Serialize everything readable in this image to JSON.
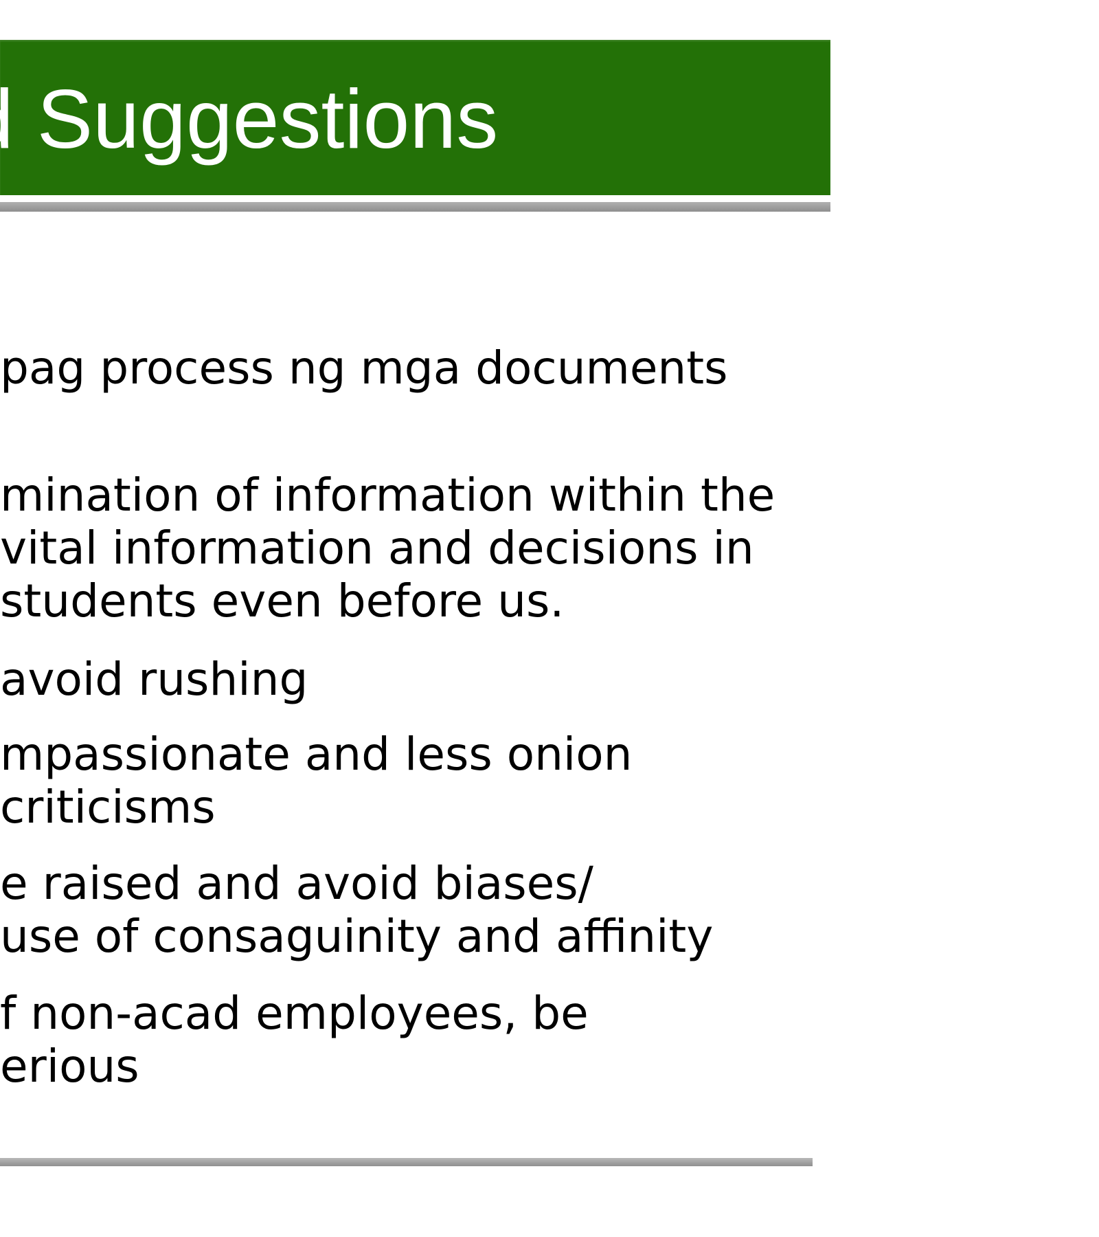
{
  "slide": {
    "title": "d Suggestions",
    "bullets": [
      {
        "lines": [
          "pag process ng mga documents"
        ]
      },
      {
        "lines": [
          "mination of information within the",
          "vital information and decisions in",
          "students even before us."
        ]
      },
      {
        "lines": [
          "avoid rushing"
        ]
      },
      {
        "lines": [
          "mpassionate and less onion",
          "  criticisms"
        ]
      },
      {
        "lines": [
          "e  raised and avoid biases/",
          "use of consaguinity and affinity"
        ]
      },
      {
        "lines": [
          "f non-acad employees, be",
          "erious"
        ]
      }
    ]
  },
  "colors": {
    "title_banner": "#237107",
    "title_text": "#ffffff",
    "rule_gray": "#999999",
    "body_text": "#000000"
  }
}
